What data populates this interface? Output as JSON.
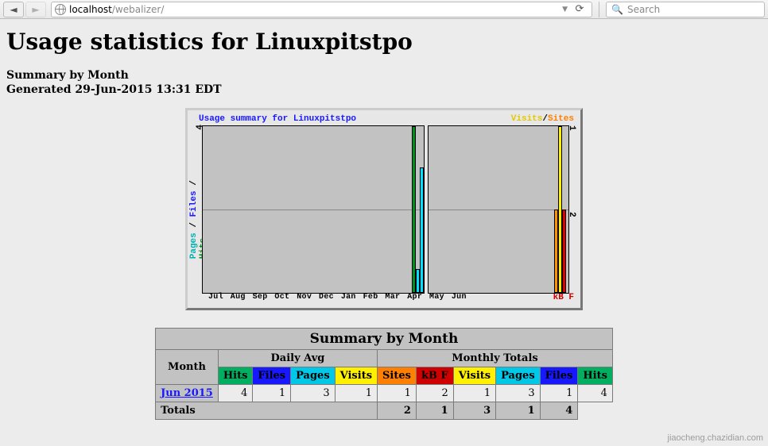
{
  "browser": {
    "url_host": "localhost",
    "url_path": "/webalizer/",
    "search_placeholder": "Search"
  },
  "page": {
    "title": "Usage statistics for Linuxpitstpo",
    "summary_label": "Summary by Month",
    "generated": "Generated 29-Jun-2015 13:31 EDT"
  },
  "chart": {
    "title": "Usage summary for Linuxpitstpo",
    "legend_visits": "Visits",
    "legend_sites": "Sites",
    "legend_kbf": "kB F",
    "y_label_pages": "Pages",
    "y_label_files": "Files",
    "y_label_hits": "Hits",
    "left_y_tick": "4",
    "right_y_tick_top": "1",
    "right_y_tick_mid": "2",
    "months": "Jul Aug Sep Oct Nov Dec Jan Feb Mar Apr May Jun"
  },
  "table": {
    "title": "Summary by Month",
    "month_header": "Month",
    "daily_avg_header": "Daily Avg",
    "monthly_totals_header": "Monthly Totals",
    "cols_daily": [
      "Hits",
      "Files",
      "Pages",
      "Visits"
    ],
    "cols_monthly": [
      "Sites",
      "kB F",
      "Visits",
      "Pages",
      "Files",
      "Hits"
    ],
    "row_month": "Jun 2015",
    "row_values": [
      "4",
      "1",
      "3",
      "1",
      "1",
      "2",
      "1",
      "3",
      "1",
      "4"
    ],
    "totals_label": "Totals",
    "totals_values": [
      "2",
      "1",
      "3",
      "1",
      "4"
    ]
  },
  "chart_data": {
    "type": "bar",
    "title": "Usage summary for Linuxpitstpo",
    "left_panel": {
      "y_series": [
        "Hits",
        "Files",
        "Pages"
      ],
      "categories": [
        "Jul",
        "Aug",
        "Sep",
        "Oct",
        "Nov",
        "Dec",
        "Jan",
        "Feb",
        "Mar",
        "Apr",
        "May",
        "Jun"
      ],
      "series": [
        {
          "name": "Hits",
          "values": [
            0,
            0,
            0,
            0,
            0,
            0,
            0,
            0,
            0,
            0,
            0,
            4
          ]
        },
        {
          "name": "Files",
          "values": [
            0,
            0,
            0,
            0,
            0,
            0,
            0,
            0,
            0,
            0,
            0,
            1
          ]
        },
        {
          "name": "Pages",
          "values": [
            0,
            0,
            0,
            0,
            0,
            0,
            0,
            0,
            0,
            0,
            0,
            3
          ]
        }
      ],
      "ylim": [
        0,
        4
      ]
    },
    "right_panel": {
      "y_series": [
        "Visits",
        "Sites",
        "kB F"
      ],
      "series": [
        {
          "name": "Visits",
          "values": [
            1
          ]
        },
        {
          "name": "Sites",
          "values": [
            1
          ]
        },
        {
          "name": "kB F",
          "values": [
            2
          ]
        }
      ],
      "ylim": [
        0,
        2
      ]
    }
  },
  "watermark": "jiaocheng.chazidian.com"
}
